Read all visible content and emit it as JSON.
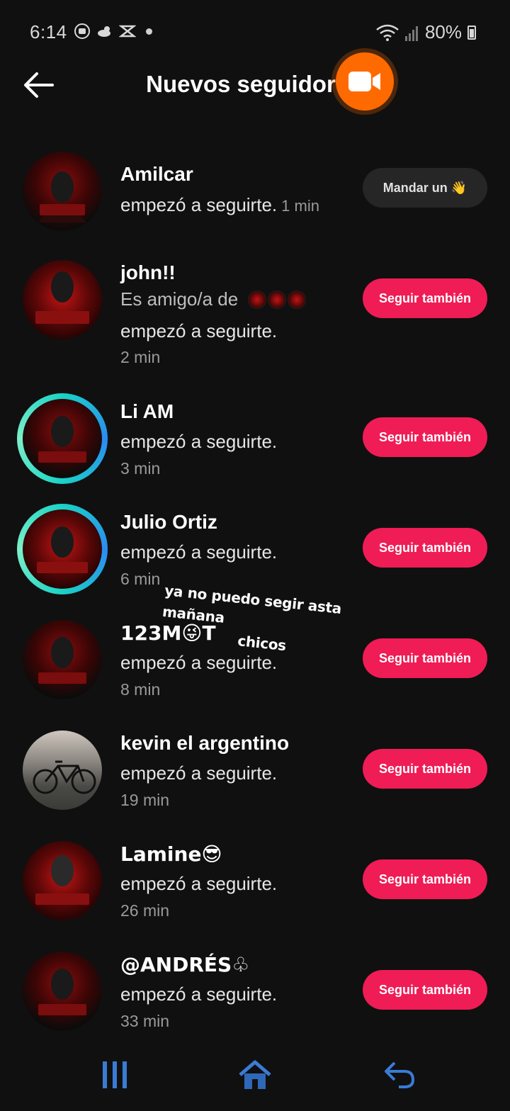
{
  "status_bar": {
    "time": "6:14",
    "battery": "80%",
    "icons": [
      "youtube-icon",
      "cloud-sun-icon",
      "capcut-icon",
      "notification-dot",
      "wifi-icon",
      "signal-icon",
      "battery-icon"
    ]
  },
  "header": {
    "title": "Nuevos seguidor",
    "back_icon": "arrow-left-icon",
    "record_icon": "video-camera-icon"
  },
  "followers": [
    {
      "name": "Amilcar",
      "action": "empezó a seguirte.",
      "time": "1 min",
      "button": "Mandar un 👋",
      "button_type": "message",
      "avatar": "team-todo-rojo"
    },
    {
      "name": "john!!",
      "mutual": "Es amigo/a de",
      "action": "empezó a seguirte.",
      "time": "2 min",
      "button": "Seguir también",
      "button_type": "follow",
      "avatar": "team-todo-rojo"
    },
    {
      "name": "Li AM",
      "action": "empezó a seguirte.",
      "time": "3 min",
      "button": "Seguir también",
      "button_type": "follow",
      "avatar": "team-todo-rojo"
    },
    {
      "name": "Julio Ortiz",
      "action": "empezó a seguirte.",
      "time": "6 min",
      "button": "Seguir también",
      "button_type": "follow",
      "avatar": "team-todo-rojo"
    },
    {
      "name": "123M😜T",
      "action": "empezó a seguirte.",
      "time": "8 min",
      "button": "Seguir también",
      "button_type": "follow",
      "avatar": "team-todo-rojo"
    },
    {
      "name": "kevin el argentino",
      "action": "empezó a seguirte.",
      "time": "19 min",
      "button": "Seguir también",
      "button_type": "follow",
      "avatar": "bicycle"
    },
    {
      "name": "Lamine😎",
      "action": "empezó a seguirte.",
      "time": "26 min",
      "button": "Seguir también",
      "button_type": "follow",
      "avatar": "team-todo-rojo"
    },
    {
      "name": "@ANDRÉS♧",
      "action": "empezó a seguirte.",
      "time": "33 min",
      "button": "Seguir también",
      "button_type": "follow",
      "avatar": "team-todo-rojo"
    }
  ],
  "overlay_note": {
    "line1": "ya no puedo segir asta mañana",
    "line2": "chicos"
  },
  "nav_bar": {
    "items": [
      "recent-apps-icon",
      "home-icon",
      "back-icon"
    ]
  },
  "colors": {
    "background": "#101010",
    "follow_button": "#f01c55",
    "message_button": "#262626",
    "record_button": "#ff6a00",
    "story_ring": "#19d3c5"
  }
}
